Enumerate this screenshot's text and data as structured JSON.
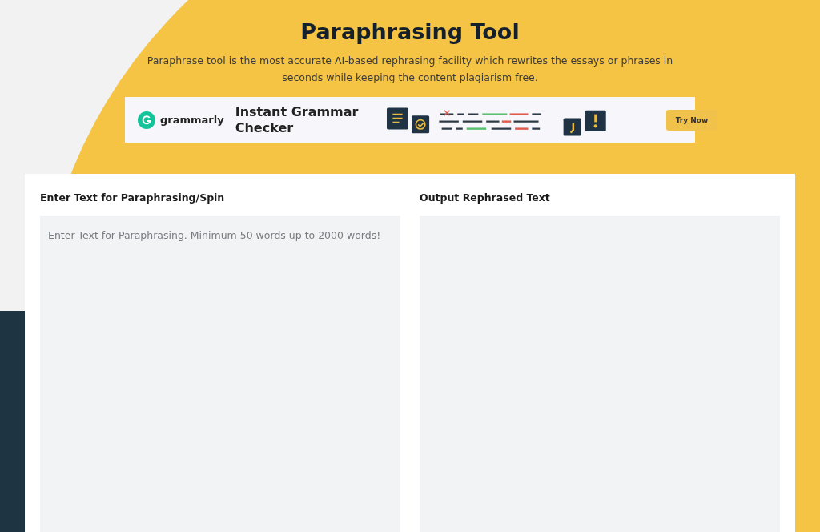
{
  "header": {
    "title": "Paraphrasing Tool",
    "subtitle": "Paraphrase tool is the most accurate AI-based rephrasing facility which rewrites the essays or phrases in seconds while keeping the content plagiarism free."
  },
  "ad": {
    "brand": "grammarly",
    "headline": "Instant Grammar Checker",
    "button": "Try Now"
  },
  "input_panel": {
    "label": "Enter Text for Paraphrasing/Spin",
    "placeholder": "Enter Text for Paraphrasing. Minimum 50 words up to 2000 words!"
  },
  "output_panel": {
    "label": "Output Rephrased Text"
  }
}
